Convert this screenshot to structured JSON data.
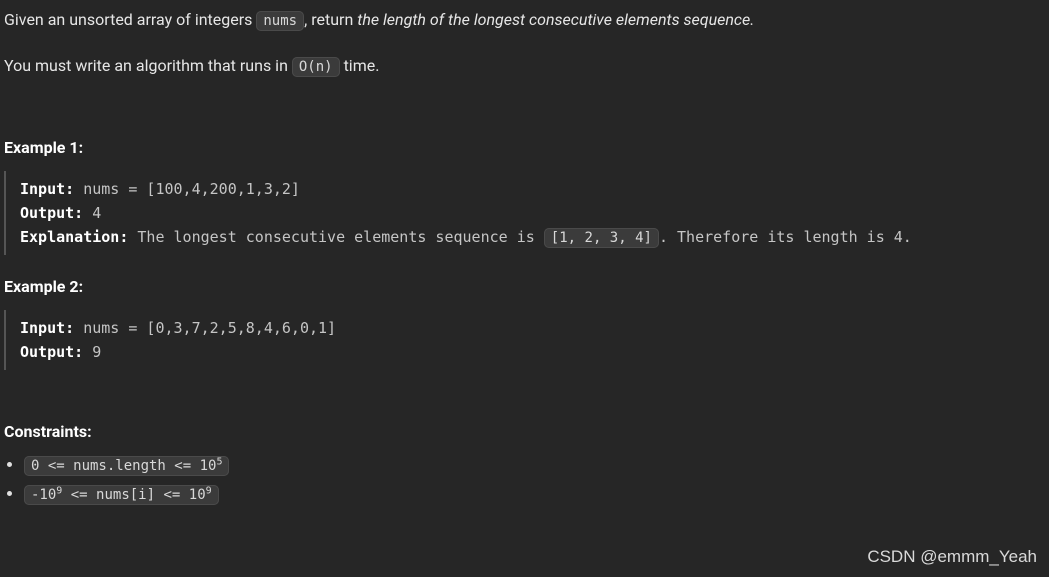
{
  "description": {
    "part1": "Given an unsorted array of integers ",
    "code1": "nums",
    "part2": ", return ",
    "italic": "the length of the longest consecutive elements sequence.",
    "line2a": "You must write an algorithm that runs in ",
    "code2": "O(n)",
    "line2b": " time."
  },
  "example1": {
    "heading": "Example 1:",
    "input_label": "Input:",
    "input_value": " nums = [100,4,200,1,3,2]",
    "output_label": "Output:",
    "output_value": " 4",
    "explanation_label": "Explanation:",
    "explanation_1": " The longest consecutive elements sequence is ",
    "explanation_code": "[1, 2, 3, 4]",
    "explanation_2": ". Therefore its length is 4."
  },
  "example2": {
    "heading": "Example 2:",
    "input_label": "Input:",
    "input_value": " nums = [0,3,7,2,5,8,4,6,0,1]",
    "output_label": "Output:",
    "output_value": " 9"
  },
  "constraints": {
    "heading": "Constraints:",
    "c1_a": "0 <= nums.length <= 10",
    "c1_sup": "5",
    "c2_a": "-10",
    "c2_sup1": "9",
    "c2_b": " <= nums[i] <= 10",
    "c2_sup2": "9"
  },
  "watermark": "CSDN @emmm_Yeah"
}
